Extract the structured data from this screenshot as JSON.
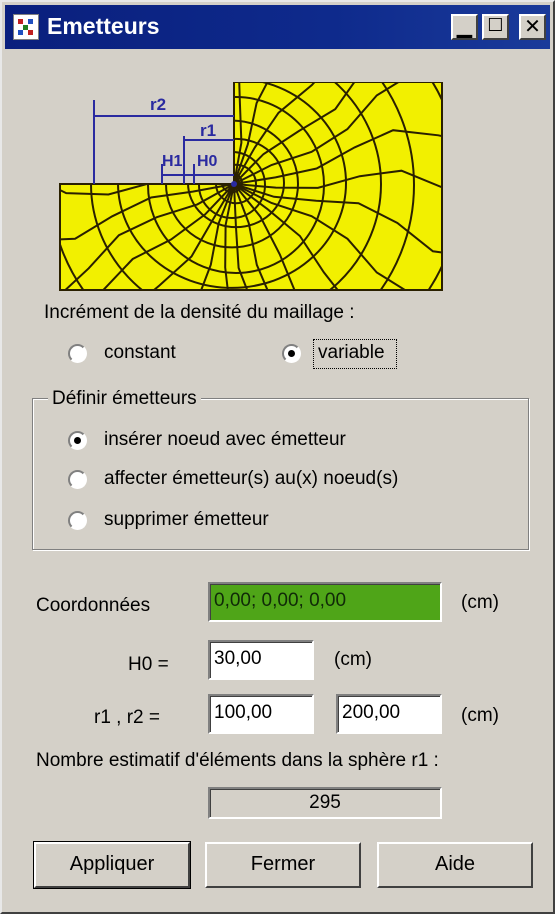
{
  "window": {
    "title": "Emetteurs",
    "buttons": {
      "minimize": "▁",
      "maximize": "☐",
      "close": "✕"
    }
  },
  "figure": {
    "labels": {
      "r2": "r2",
      "r1": "r1",
      "h1": "H1",
      "h0": "H0"
    },
    "colors": {
      "mesh_fill": "#f2f000",
      "mesh_line": "#2a2000",
      "dimension": "#2a2aa0"
    }
  },
  "mesh_density": {
    "heading": "Incrément de la densité du maillage :",
    "options": [
      {
        "label": "constant",
        "checked": false
      },
      {
        "label": "variable",
        "checked": true
      }
    ]
  },
  "define_emitters": {
    "heading": "Définir émetteurs",
    "options": [
      {
        "label": "insérer noeud avec émetteur",
        "checked": true
      },
      {
        "label": "affecter émetteur(s) au(x) noeud(s)",
        "checked": false
      },
      {
        "label": "supprimer émetteur",
        "checked": false
      }
    ]
  },
  "coords": {
    "label": "Coordonnées",
    "value": "0,00; 0,00; 0,00",
    "unit": "(cm)"
  },
  "h0": {
    "label": "H0 =",
    "value": "30,00",
    "unit": "(cm)"
  },
  "r1r2": {
    "label": "r1 , r2 =",
    "r1": "100,00",
    "r2": "200,00",
    "unit": "(cm)"
  },
  "estimate": {
    "label": "Nombre estimatif d'éléments dans la sphère r1 :",
    "value": "295"
  },
  "actions": {
    "apply": "Appliquer",
    "close": "Fermer",
    "help": "Aide"
  },
  "colors": {
    "title_bar": "#0a1f7d",
    "face": "#d4d0c8",
    "coords_field": "#4fa518"
  }
}
